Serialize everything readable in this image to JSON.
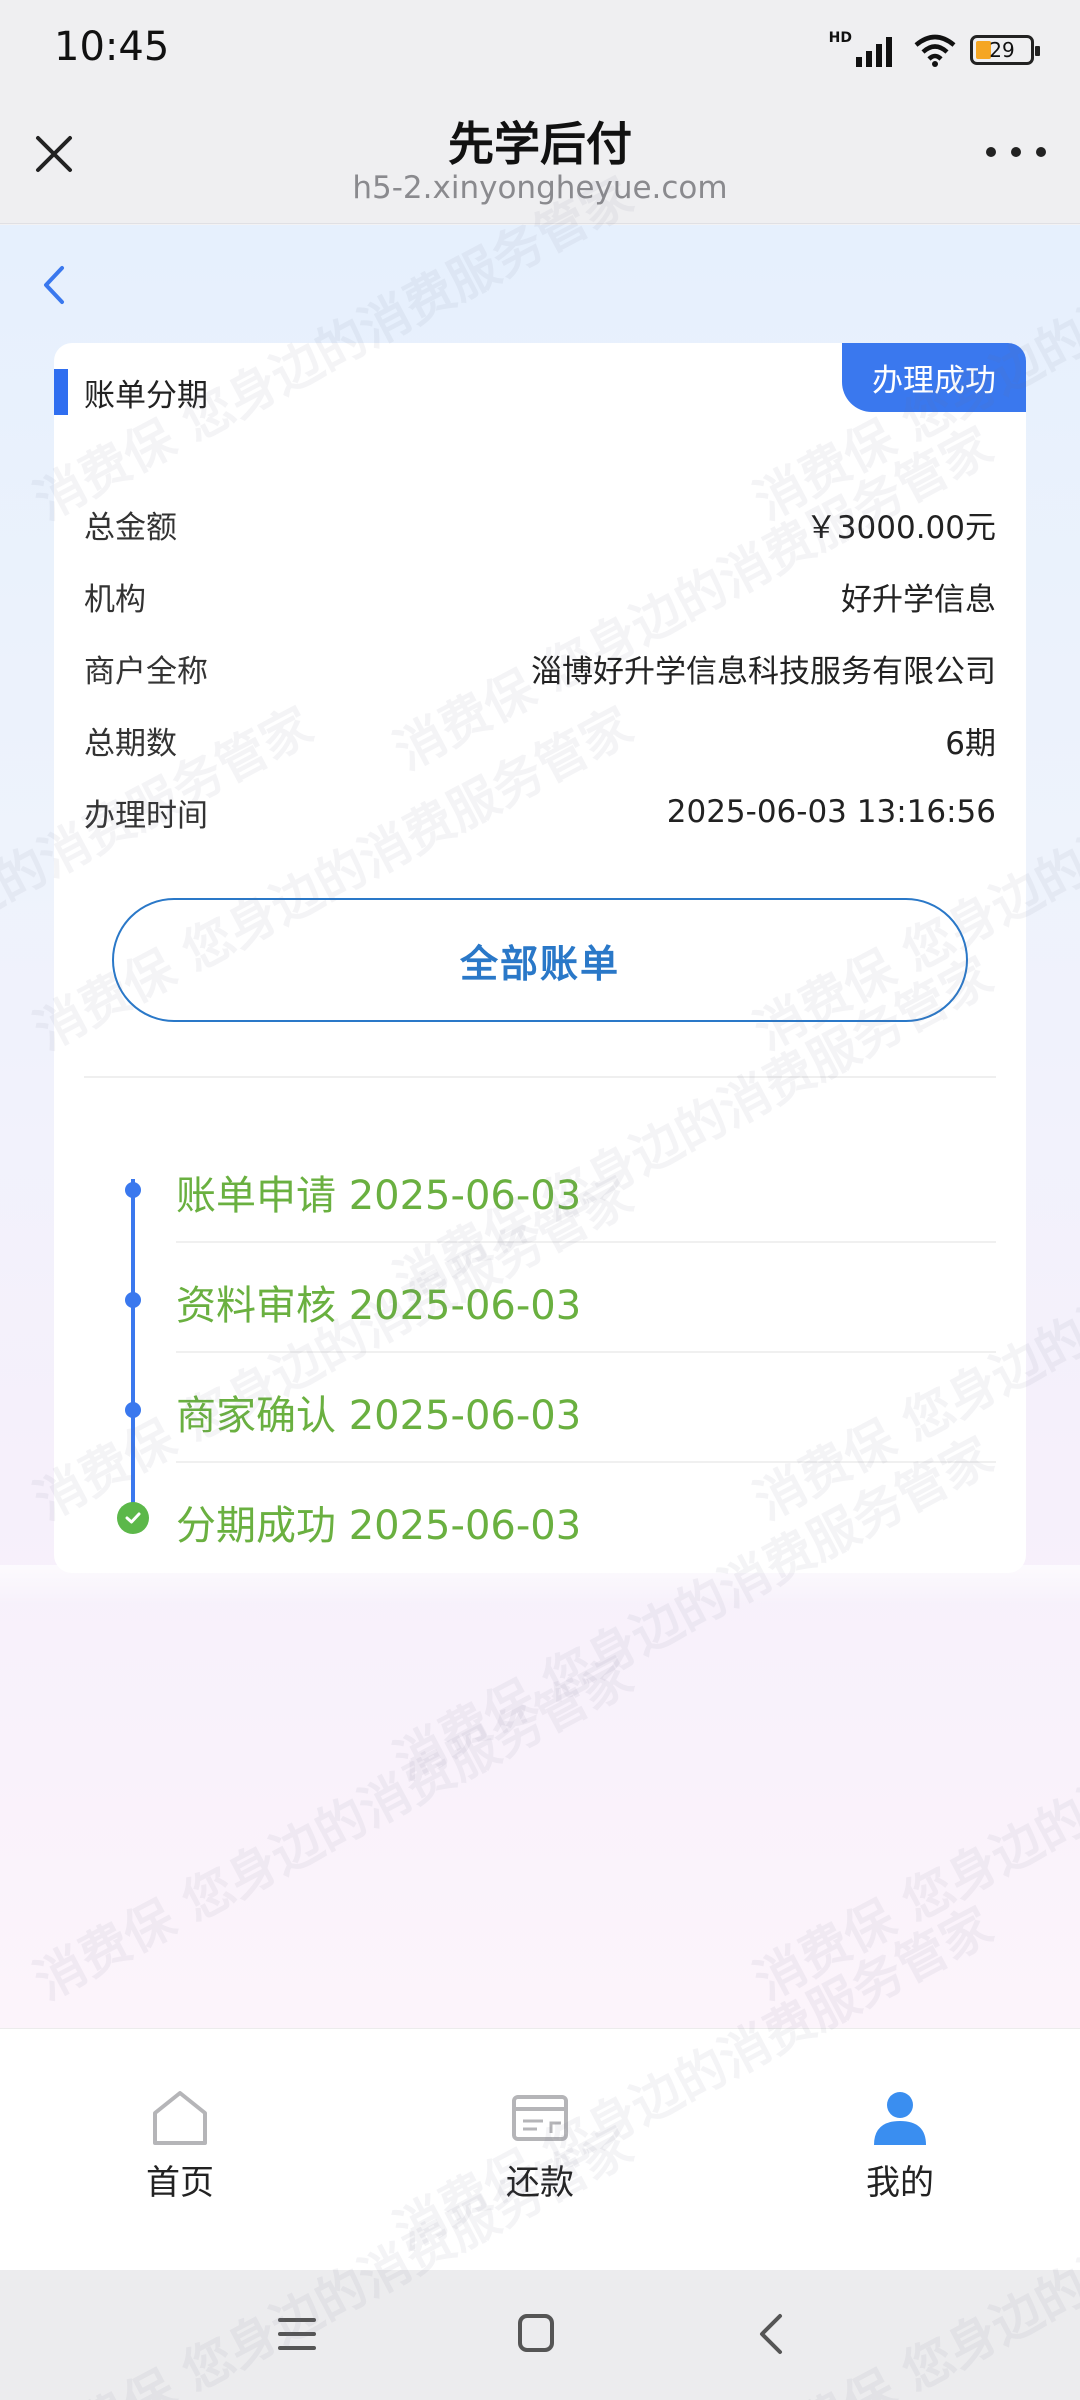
{
  "status_bar": {
    "time": "10:45",
    "network_label": "HD",
    "battery_level": "29",
    "battery_fraction": 0.29
  },
  "browser": {
    "title": "先学后付",
    "url": "h5-2.xinyongheyue.com"
  },
  "card": {
    "section_title": "账单分期",
    "status_tag": "办理成功",
    "rows": [
      {
        "label": "总金额",
        "value": "￥3000.00元"
      },
      {
        "label": "机构",
        "value": "好升学信息"
      },
      {
        "label": "商户全称",
        "value": "淄博好升学信息科技服务有限公司"
      },
      {
        "label": "总期数",
        "value": "6期"
      },
      {
        "label": "办理时间",
        "value": "2025-06-03 13:16:56"
      }
    ],
    "all_bills_button": "全部账单"
  },
  "timeline": [
    {
      "text": "账单申请 2025-06-03",
      "state": "done"
    },
    {
      "text": "资料审核 2025-06-03",
      "state": "done"
    },
    {
      "text": "商家确认 2025-06-03",
      "state": "done"
    },
    {
      "text": "分期成功 2025-06-03",
      "state": "success"
    }
  ],
  "watermark": "消费保 您身边的消费服务管家",
  "tabs": {
    "home": "首页",
    "repay": "还款",
    "mine": "我的"
  },
  "colors": {
    "primary_blue": "#3a78ee",
    "timeline_green": "#6ab040",
    "button_blue": "#2a78c8"
  }
}
